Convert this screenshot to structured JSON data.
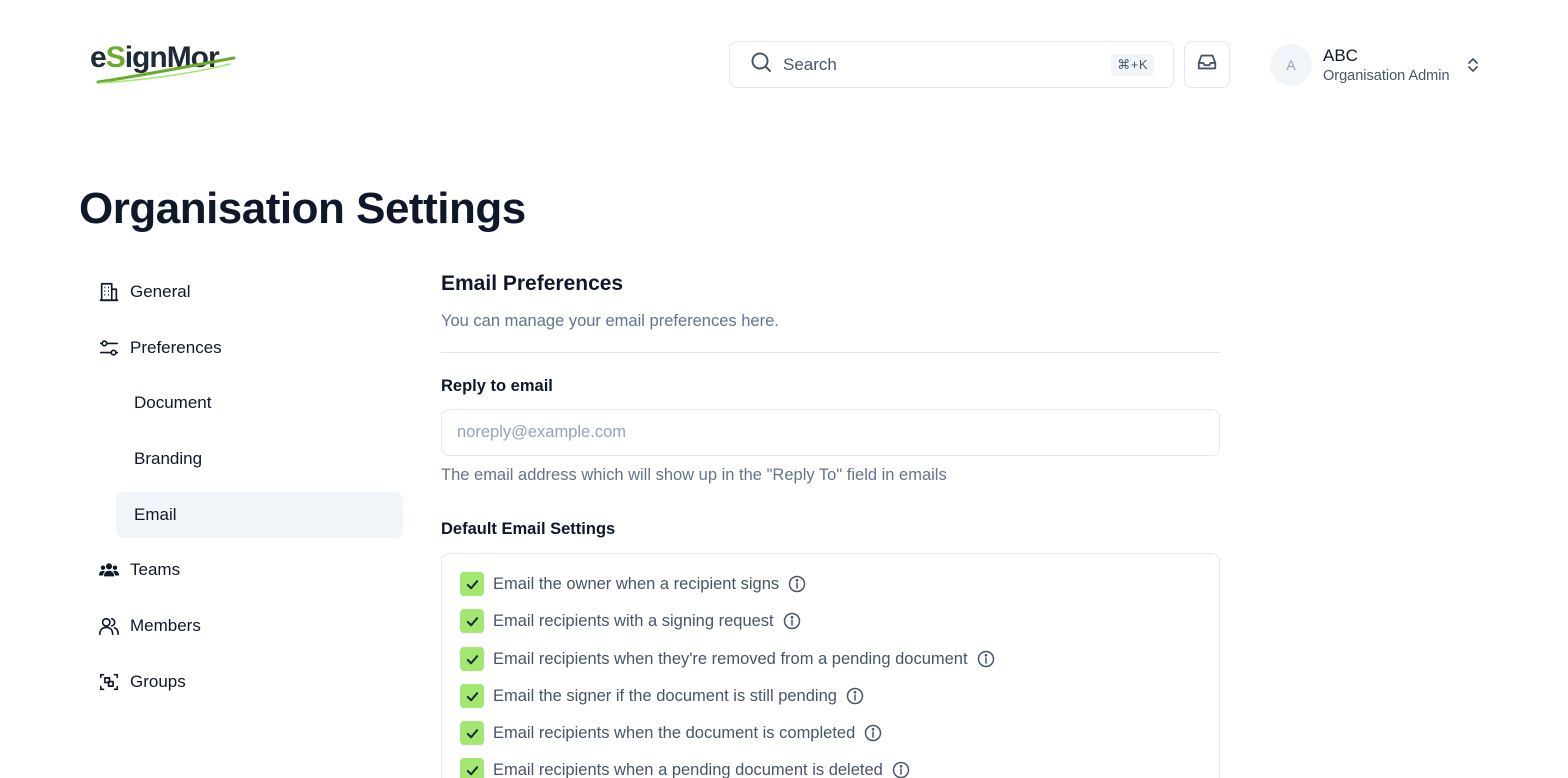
{
  "header": {
    "logo_text": "eSignMor",
    "search_placeholder": "Search",
    "search_shortcut": "⌘+K",
    "user": {
      "initial": "A",
      "name": "ABC",
      "role": "Organisation Admin"
    }
  },
  "page_title": "Organisation Settings",
  "sidebar": {
    "items": [
      {
        "label": "General",
        "icon": "building-icon"
      },
      {
        "label": "Preferences",
        "icon": "sliders-icon"
      },
      {
        "label": "Document"
      },
      {
        "label": "Branding"
      },
      {
        "label": "Email",
        "active": true
      },
      {
        "label": "Teams",
        "icon": "users-group-icon"
      },
      {
        "label": "Members",
        "icon": "users-icon"
      },
      {
        "label": "Groups",
        "icon": "group-scan-icon"
      }
    ]
  },
  "main": {
    "section_title": "Email Preferences",
    "section_desc": "You can manage your email preferences here.",
    "reply_label": "Reply to email",
    "reply_placeholder": "noreply@example.com",
    "reply_value": "",
    "reply_help": "The email address which will show up in the \"Reply To\" field in emails",
    "defaults_label": "Default Email Settings",
    "checkboxes": [
      {
        "label": "Email the owner when a recipient signs",
        "checked": true
      },
      {
        "label": "Email recipients with a signing request",
        "checked": true
      },
      {
        "label": "Email recipients when they're removed from a pending document",
        "checked": true
      },
      {
        "label": "Email the signer if the document is still pending",
        "checked": true
      },
      {
        "label": "Email recipients when the document is completed",
        "checked": true
      },
      {
        "label": "Email recipients when a pending document is deleted",
        "checked": true
      }
    ]
  },
  "colors": {
    "checkbox": "#a2e771",
    "active_nav_bg": "#f1f5f9",
    "logo_dark": "#1f2937",
    "logo_green": "#6bab2f"
  }
}
